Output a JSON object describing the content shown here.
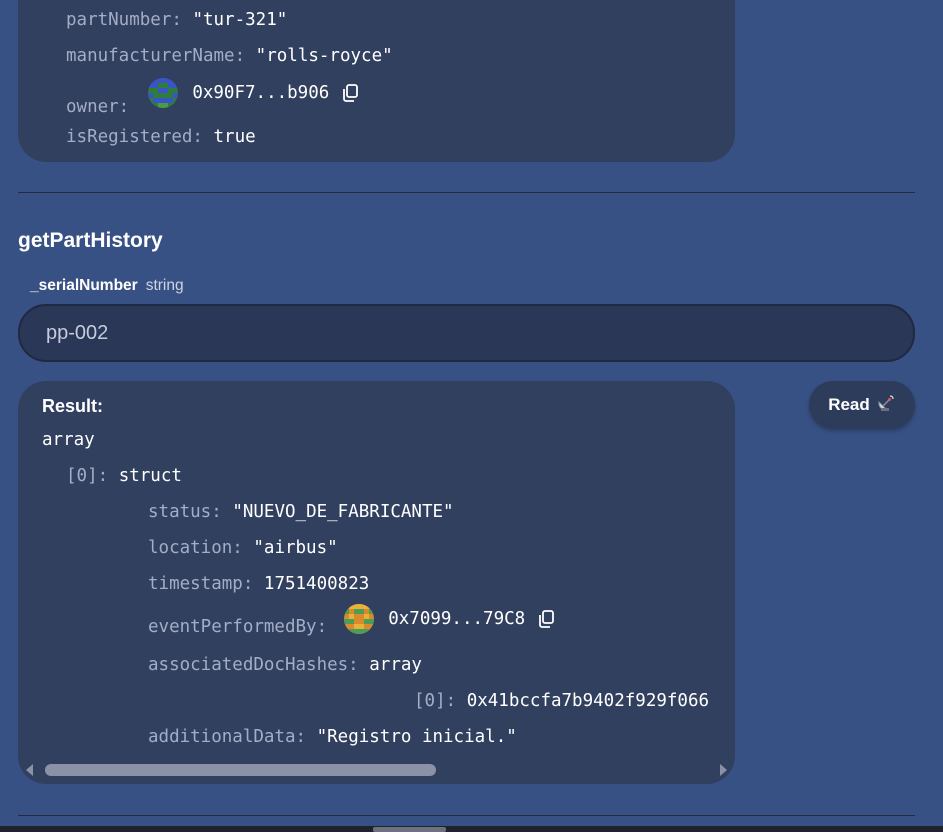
{
  "prev_result": {
    "part_number_key": "partNumber:",
    "part_number_val": "\"tur-321\"",
    "manufacturer_key": "manufacturerName:",
    "manufacturer_val": "\"rolls-royce\"",
    "owner_key": "owner:",
    "owner_addr": "0x90F7...b906",
    "registered_key": "isRegistered:",
    "registered_val": "true"
  },
  "function": {
    "name": "getPartHistory",
    "param_name": "_serialNumber",
    "param_type": "string",
    "input_value": "pp-002",
    "read_label": "Read",
    "read_icon": "satellite-dish-icon"
  },
  "result": {
    "label": "Result:",
    "root_type": "array",
    "item_index": "[0]:",
    "item_type": "struct",
    "status_key": "status:",
    "status_val": "\"NUEVO_DE_FABRICANTE\"",
    "location_key": "location:",
    "location_val": "\"airbus\"",
    "timestamp_key": "timestamp:",
    "timestamp_val": "1751400823",
    "event_key": "eventPerformedBy:",
    "event_addr": "0x7099...79C8",
    "doc_hashes_key": "associatedDocHashes:",
    "doc_hashes_type": "array",
    "hash_index": "[0]:",
    "hash_val": "0x41bccfa7b9402f929f066",
    "additional_key": "additionalData:",
    "additional_val": "\"Registro inicial.\""
  },
  "colors": {
    "background": "#385184",
    "card": "#31405f",
    "key_text": "#a3adc7"
  }
}
